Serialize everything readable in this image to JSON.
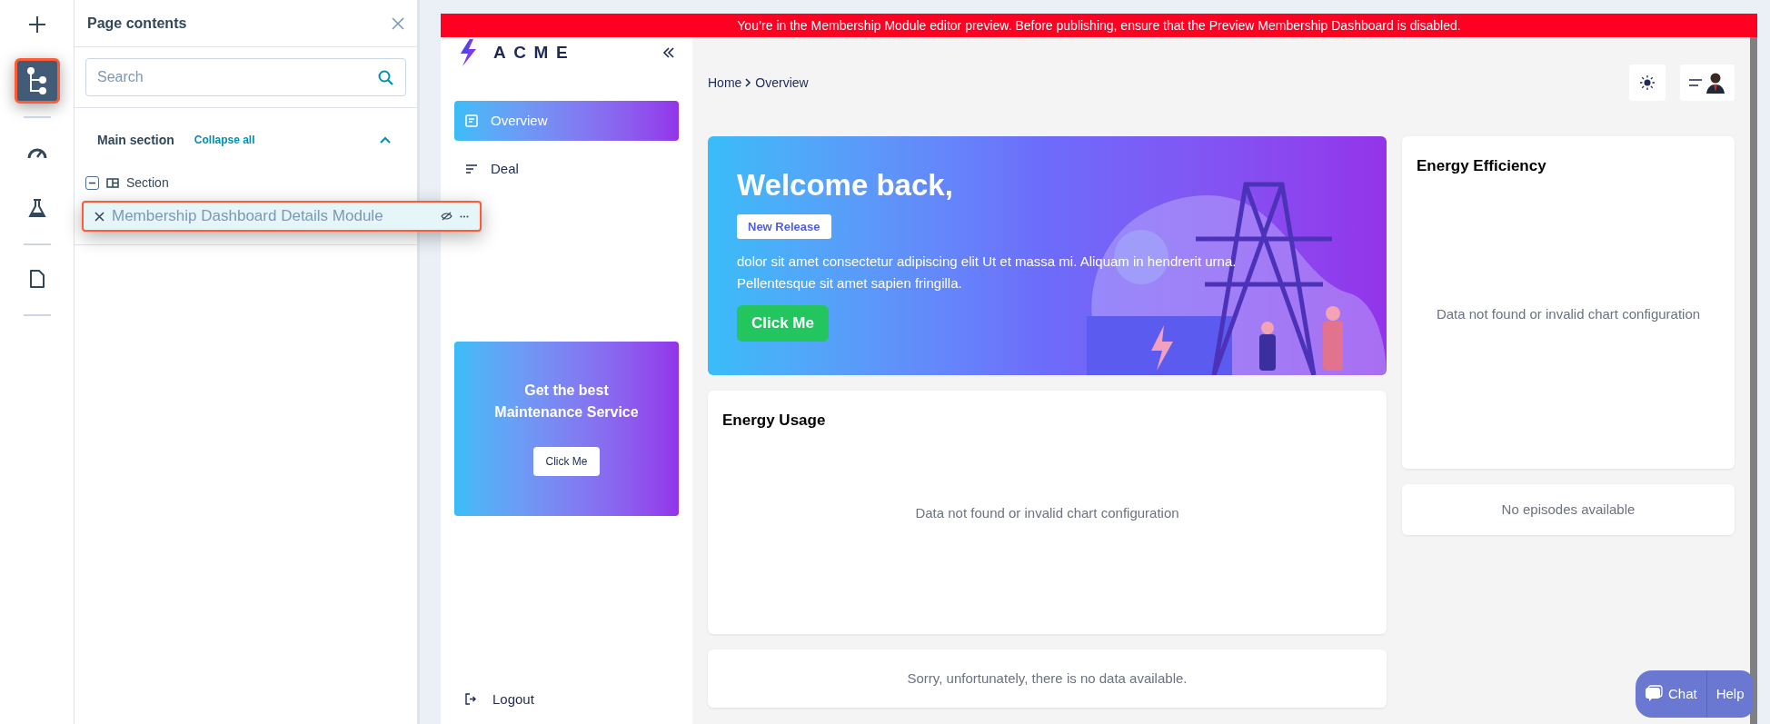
{
  "rail": {
    "items": [
      {
        "kind": "add",
        "selected": false
      },
      {
        "kind": "tree",
        "selected": true
      },
      {
        "kind": "gauge",
        "selected": false
      },
      {
        "kind": "flask",
        "selected": false
      },
      {
        "kind": "page",
        "selected": false
      }
    ]
  },
  "panel": {
    "title": "Page contents",
    "search": {
      "placeholder": "Search"
    },
    "section": {
      "title": "Main section",
      "action": "Collapse all",
      "expanded": true
    },
    "tree": [
      {
        "label": "Section",
        "expanded": true,
        "children": [
          {
            "label": "Membership Dashboard Details Module",
            "selected": true
          }
        ]
      }
    ]
  },
  "preview": {
    "notice": "You’re in the Membership Module editor preview. Before publishing, ensure that the Preview Membership Dashboard is disabled.",
    "brand": "ACME",
    "nav": [
      {
        "label": "Overview",
        "kind": "overview",
        "selected": true
      },
      {
        "label": "Deal",
        "kind": "deal",
        "selected": false
      }
    ],
    "promo": {
      "title": "Get the best Maintenance Service",
      "button": "Click Me"
    },
    "logout": "Logout",
    "breadcrumb": [
      "Home",
      "Overview"
    ],
    "hero": {
      "title": "Welcome back,",
      "badge": "New Release",
      "text": "dolor sit amet consectetur adipiscing elit Ut et massa mi. Aliquam in hendrerit urna. Pellentesque sit amet sapien fringilla.",
      "button": "Click Me"
    },
    "energy_usage": {
      "title": "Energy Usage",
      "message": "Data not found or invalid chart configuration"
    },
    "usage_note": "Sorry, unfortunately, there is no data available.",
    "energy_efficiency": {
      "title": "Energy Efficiency",
      "message": "Data not found or invalid chart configuration"
    },
    "episodes_note": "No episodes available"
  },
  "chat": {
    "chat": "Chat",
    "help": "Help"
  }
}
